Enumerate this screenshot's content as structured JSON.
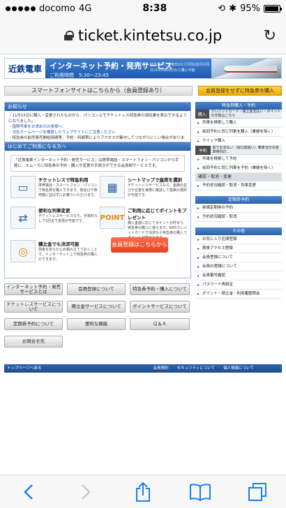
{
  "status": {
    "carrier": "docomo",
    "network": "4G",
    "time": "8:38",
    "battery": "95%"
  },
  "browser": {
    "url": "ticket.kintetsu.co.jp"
  },
  "banner": {
    "logo": "近鉄電車",
    "title": "インターネット予約・発売サービス",
    "hours": "ご利用時間　5:30〜23:45",
    "note": "特急券のご乗車日の1カ月前(前月の同日)の10時00分から購入可能"
  },
  "top": {
    "smartphone_link": "スマートフォンサイトはこちらから（会員登録あり）",
    "buy_without_signup": "会員登録をせずに特急券を購入"
  },
  "news": {
    "header": "お知らせ",
    "items": [
      "・11月15日に購入・変更されたものから、パソコン上でチケットレス特急券の領収書を表示できるようになりました。",
      "・国際号車をお求めのお客様へ",
      "・当社ホームページを模倣したウェブサイトにご注意ください",
      "・特急券の前売発売開始時間等、予約・時間帯によりアクセスが集中してつながりにくい場合があります。"
    ]
  },
  "intro": {
    "header": "はじめてご利用になる方へ",
    "desc": "「近鉄電車インターネット予約・発売サービス」は携帯電話・スマートフォン・パソコンから手軽に、スムーズに特急券の予約・購入や変更の手続きができる会員制サービスです。",
    "features": [
      {
        "title": "チケットレスで特急利用",
        "text": "携帯電話・スマートフォン・パソコンで特急券を購入できます。駅窓口や券売機に並ばずにお乗りいただけます。",
        "icon": "devices-icon"
      },
      {
        "title": "シートマップで座席を選択",
        "text": "チケットレスサービスなら、座席の並びや位置を実際に確認して座席の選択が可能です。",
        "icon": "seat-map-icon"
      },
      {
        "title": "便利な列車変更",
        "text": "チケットレスサービスなら、手数料なしで1回まで変更が可能です。",
        "icon": "train-icon"
      },
      {
        "title": "ご利用に応じてポイントをプレゼント",
        "text": "購入金額に応じてポイントが貯まり、特急券の購入に使えます。KIPSクレジットカードで決済なら特急券の購入でポイントが貯まります。",
        "icon": "point-icon"
      },
      {
        "title": "積立金でも決済可能",
        "text": "現金をあらかじめ積み立てておくことで、インターネット上で特急券の購入ができます。",
        "icon": "coins-icon"
      }
    ],
    "join_button": "会員登録はこちらから"
  },
  "buttons": [
    "インターネット予約・発売サービスとは",
    "会員登録について",
    "特急券予約・購入について",
    "チケットレスサービスについて",
    "積立金サービスについて",
    "ポイントサービスについて",
    "定期券予約について",
    "便利な機能",
    "Ｑ＆Ａ",
    "お問合せ先"
  ],
  "sidebar": {
    "buy_header": "特急券購入・予約",
    "buy_tab": {
      "label": "購入",
      "text": "クレジットカード・積立金支払い・ポイントの交換はこちら"
    },
    "buy_items": [
      "列車を検索して購入",
      "前回予約と同じ列車を購入（乗継を除く）",
      "クイック購入"
    ],
    "reserve_tab": {
      "label": "予約",
      "text": "駅でお支払い（窓口取扱い）乗車当日の発車時刻の..."
    },
    "reserve_items": [
      "列車を検索して予約",
      "前回予約と同じ列車を予約（乗継を除く）"
    ],
    "confirm_header": "確認・取消・変更",
    "confirm_items": [
      "予約状況確認・取消・列車変更"
    ],
    "commuter_header": "定期券予約",
    "commuter_items": [
      "新規定期券の予約",
      "予約状況確認・取消"
    ],
    "other_header": "その他",
    "other_items": [
      "お気に入り区間登録",
      "簡単アクセス登録",
      "会員登録について",
      "会員ID登録について",
      "会員番号確認",
      "パスワード再設定",
      "ポイント・積立金・利用履歴照会"
    ]
  },
  "footer": {
    "back_to_top": "トップページへ戻る",
    "links": [
      "会員規約",
      "セキュリティについて",
      "個人情報について"
    ]
  },
  "toolbar": {
    "back": "back-icon",
    "forward": "forward-icon",
    "share": "share-icon",
    "bookmarks": "bookmarks-icon",
    "tabs": "tabs-icon"
  }
}
